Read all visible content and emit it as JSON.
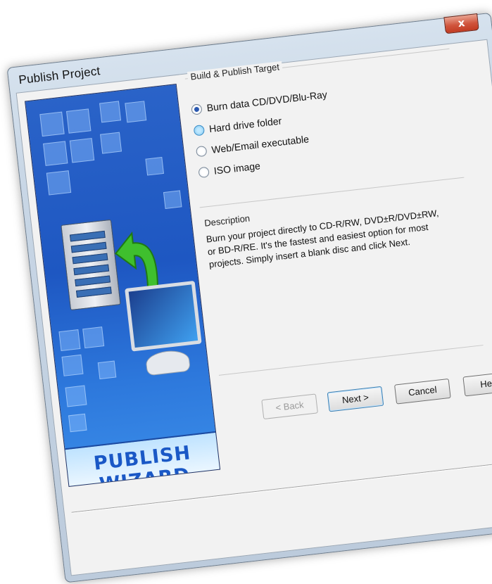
{
  "window": {
    "title": "Publish Project",
    "close_glyph": "x"
  },
  "banner": {
    "label": "PUBLISH WIZARD",
    "icons": [
      "server-icon",
      "back-arrow-icon",
      "monitor-icon"
    ]
  },
  "target": {
    "group_title": "Build & Publish Target",
    "options": [
      {
        "label": "Burn data CD/DVD/Blu-Ray",
        "selected": true
      },
      {
        "label": "Hard drive folder",
        "selected": false
      },
      {
        "label": "Web/Email executable",
        "selected": false
      },
      {
        "label": "ISO image",
        "selected": false
      }
    ]
  },
  "description": {
    "title": "Description",
    "text": "Burn your project directly to CD-R/RW, DVD±R/DVD±RW, or BD-R/RE. It's the fastest and easiest option for most projects. Simply insert a blank disc and click Next."
  },
  "buttons": {
    "back": "< Back",
    "next": "Next >",
    "cancel": "Cancel",
    "help": "Help"
  },
  "colors": {
    "banner_blue": "#1e57c2",
    "close_red": "#c23b22",
    "selection_blue": "#2a58b0"
  }
}
